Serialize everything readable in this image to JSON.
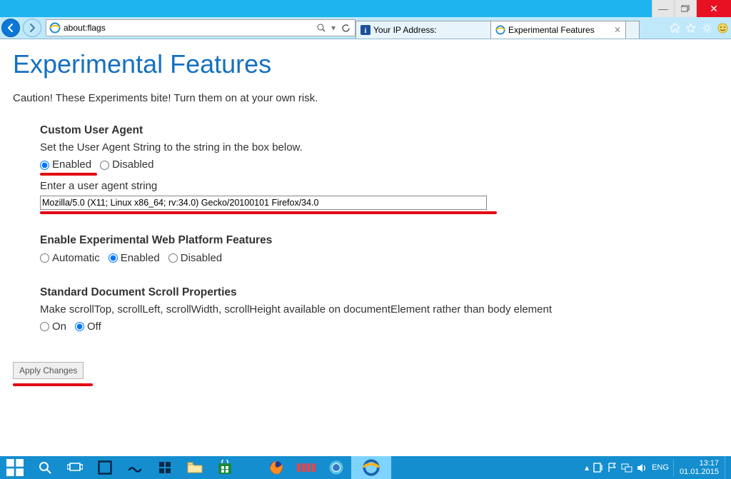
{
  "window": {
    "url": "about:flags",
    "tabs": [
      {
        "label": "Your IP Address:",
        "active": false
      },
      {
        "label": "Experimental Features",
        "active": true
      }
    ]
  },
  "page": {
    "title": "Experimental Features",
    "caution": "Caution! These Experiments bite! Turn them on at your own risk.",
    "sections": {
      "ua": {
        "title": "Custom User Agent",
        "desc": "Set the User Agent String to the string in the box below.",
        "enabled_label": "Enabled",
        "disabled_label": "Disabled",
        "enter_label": "Enter a user agent string",
        "value": "Mozilla/5.0 (X11; Linux x86_64; rv:34.0) Gecko/20100101 Firefox/34.0"
      },
      "webplat": {
        "title": "Enable Experimental Web Platform Features",
        "auto_label": "Automatic",
        "enabled_label": "Enabled",
        "disabled_label": "Disabled"
      },
      "scroll": {
        "title": "Standard Document Scroll Properties",
        "desc": "Make scrollTop, scrollLeft, scrollWidth, scrollHeight available on documentElement rather than body element",
        "on_label": "On",
        "off_label": "Off"
      }
    },
    "apply_label": "Apply Changes"
  },
  "taskbar": {
    "lang": "ENG",
    "time": "13:17",
    "date": "01.01.2015"
  }
}
